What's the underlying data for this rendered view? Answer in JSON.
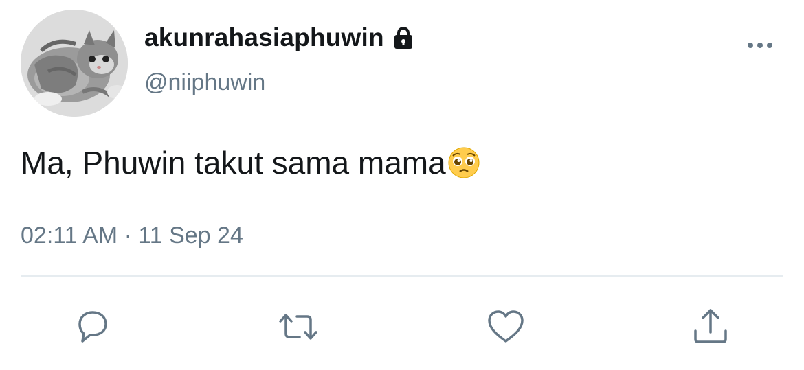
{
  "user": {
    "display_name": "akunrahasiaphuwin",
    "handle": "@niiphuwin",
    "protected_icon": "lock-icon",
    "avatar": "kitten-avatar"
  },
  "tweet": {
    "text": "Ma, Phuwin takut sama mama",
    "emoji": "pleading-face-emoji",
    "timestamp": "02:11 AM · 11 Sep 24"
  },
  "actions": [
    {
      "name": "reply",
      "icon": "reply-icon"
    },
    {
      "name": "retweet",
      "icon": "retweet-icon"
    },
    {
      "name": "like",
      "icon": "heart-icon"
    },
    {
      "name": "share",
      "icon": "share-icon"
    }
  ],
  "colors": {
    "text_primary": "#14171a",
    "text_secondary": "#657786",
    "icon": "#657786",
    "divider": "#e6ecf0"
  }
}
